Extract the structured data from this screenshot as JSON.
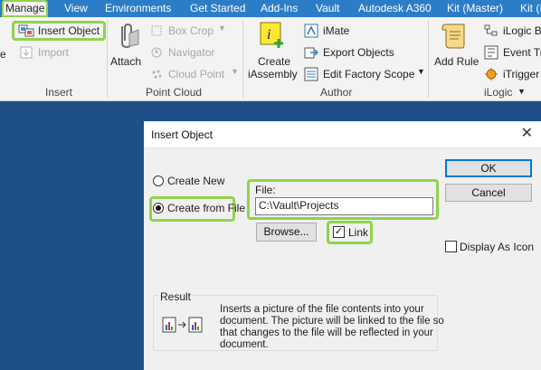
{
  "ribbon_tabs": [
    {
      "label": "Manage",
      "active": true
    },
    {
      "label": "View"
    },
    {
      "label": "Environments"
    },
    {
      "label": "Get Started"
    },
    {
      "label": "Add-Ins"
    },
    {
      "label": "Vault"
    },
    {
      "label": "Autodesk A360"
    },
    {
      "label": "Kit (Master)"
    },
    {
      "label": "Kit (I"
    }
  ],
  "ribbon": {
    "left_cut_label": "e",
    "insert_group": {
      "insert_object": "Insert Object",
      "import": "Import",
      "label": "Insert"
    },
    "point_cloud_group": {
      "attach": "Attach",
      "box_crop": "Box Crop",
      "navigator": "Navigator",
      "cloud_point": "Cloud Point",
      "label": "Point Cloud"
    },
    "author_group": {
      "create_iassembly_line1": "Create",
      "create_iassembly_line2": "iAssembly",
      "imate": "iMate",
      "export_objects": "Export Objects",
      "edit_factory_scope": "Edit Factory Scope",
      "label": "Author"
    },
    "ilogic_group": {
      "add_rule": "Add Rule",
      "ilogic_browser": "iLogic B",
      "event_triggers": "Event Tr",
      "itrigger": "iTrigger",
      "label": "iLogic"
    }
  },
  "dialog": {
    "title": "Insert Object",
    "close_glyph": "✕",
    "create_new": "Create New",
    "create_from_file": "Create from File",
    "file_label": "File:",
    "file_value": "C:\\Vault\\Projects",
    "browse": "Browse...",
    "link": "Link",
    "link_checked": true,
    "ok": "OK",
    "cancel": "Cancel",
    "display_as_icon": "Display As Icon",
    "display_as_icon_checked": false,
    "result_title": "Result",
    "result_text_1": "Inserts a picture of the file contents into your",
    "result_text_2": "document.  The picture will be linked to the file so",
    "result_text_3": "that changes to the file will be reflected in your",
    "result_text_4": "document."
  },
  "colors": {
    "tab_bar": "#2c7dc7",
    "highlight": "#8fd34a",
    "workspace": "#1e4f86",
    "ok_border": "#0078d7"
  }
}
